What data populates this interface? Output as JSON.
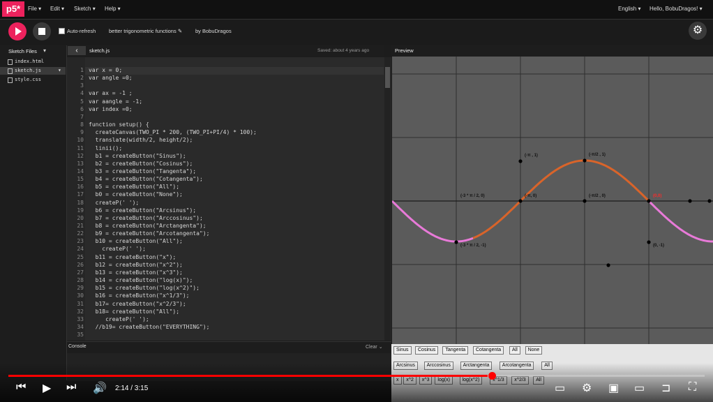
{
  "app": {
    "logo": "p5*",
    "menu": [
      "File",
      "Edit",
      "Sketch",
      "Help"
    ],
    "language": "English",
    "greeting": "Hello, BobuDragos!"
  },
  "toolbar": {
    "autorefresh_label": "Auto-refresh",
    "sketch_name": "better trigonometric functions",
    "author": "by BobuDragos"
  },
  "sidebar": {
    "title": "Sketch Files",
    "files": [
      "index.html",
      "sketch.js",
      "style.css"
    ]
  },
  "editor": {
    "tab": "sketch.js",
    "saved": "Saved: about 4 years ago",
    "lines": [
      "var x = 0;",
      "var angle =0;",
      "",
      "var ax = -1 ;",
      "var aangle = -1;",
      "var index =0;",
      "",
      "function setup() {",
      "  createCanvas(TWO_PI * 200, (TWO_PI+PI/4) * 100);",
      "  translate(width/2, height/2);",
      "  linii();",
      "  b1 = createButton(\"Sinus\");",
      "  b2 = createButton(\"Cosinus\");",
      "  b3 = createButton(\"Tangenta\");",
      "  b4 = createButton(\"Cotangenta\");",
      "  b5 = createButton(\"All\");",
      "  b0 = createButton(\"None\");",
      "  createP(' ');",
      "  b6 = createButton(\"Arcsinus\");",
      "  b7 = createButton(\"Arccosinus\");",
      "  b8 = createButton(\"Arctangenta\");",
      "  b9 = createButton(\"Arcotangenta\");",
      "  b10 = createButton(\"All\");",
      "    createP(' ');",
      "  b11 = createButton(\"x\");",
      "  b12 = createButton(\"x^2\");",
      "  b13 = createButton(\"x^3\");",
      "  b14 = createButton(\"log(x)\");",
      "  b15 = createButton(\"log(x^2)\");",
      "  b16 = createButton(\"x^1/3\");",
      "  b17= createButton(\"x^2/3\");",
      "  b18= createButton(\"All\");",
      "     createP(' ');",
      "  //b19= createButton(\"EVERYTHING\");",
      ""
    ]
  },
  "console": {
    "title": "Console",
    "clear": "Clear"
  },
  "preview": {
    "title": "Preview",
    "labels": [
      "(-π , 1)",
      "(-π/2 , 1)",
      "(-3 * π / 2, 0)",
      "(-π, 0)",
      "(-π/2 , 0)",
      "(0,0)",
      "(-3 * π / 2, -1)",
      "(0, -1)"
    ],
    "row1": [
      "Sinus",
      "Cosinus",
      "Tangenta",
      "Cotangenta",
      "All",
      "None"
    ],
    "row2": [
      "Arcsinus",
      "Arccosinus",
      "Arctangenta",
      "Arcotangenta",
      "All"
    ],
    "row3": [
      "x",
      "x^2",
      "x^3",
      "log(x)",
      "log(x^2)",
      "x^1/3",
      "x^2/3",
      "All"
    ],
    "colors": {
      "sine_pink": "#e87ad8",
      "sine_orange": "#d9642a",
      "origin_red": "#ff2a2a"
    }
  },
  "player": {
    "time": "2:14 / 3:15",
    "progress": 0.688
  }
}
